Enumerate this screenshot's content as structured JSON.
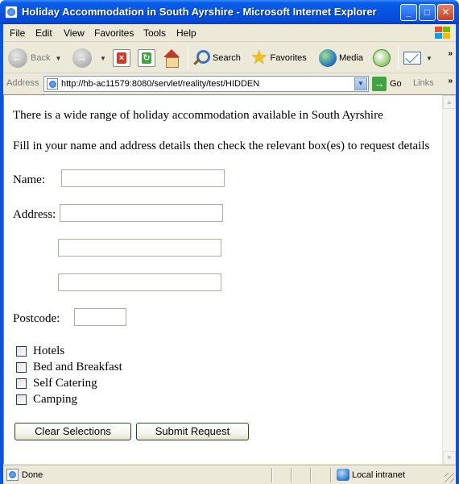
{
  "window": {
    "title": "Holiday Accommodation in South Ayrshire - Microsoft Internet Explorer",
    "min_glyph": "_",
    "max_glyph": "□",
    "close_glyph": "✕"
  },
  "menu": {
    "items": [
      {
        "label": "File"
      },
      {
        "label": "Edit"
      },
      {
        "label": "View"
      },
      {
        "label": "Favorites"
      },
      {
        "label": "Tools"
      },
      {
        "label": "Help"
      }
    ]
  },
  "toolbar": {
    "back_label": "Back",
    "search_label": "Search",
    "favorites_label": "Favorites",
    "media_label": "Media",
    "more_glyph": "»"
  },
  "address_bar": {
    "label": "Address",
    "url": "http://hb-ac11579:8080/servlet/reality/test/HIDDEN",
    "go_label": "Go",
    "links_label": "Links",
    "links_more": "»"
  },
  "page": {
    "intro": "There is a wide range of holiday accommodation available in South Ayrshire",
    "instructions": "Fill in your name and address details then check the relevant box(es) to request details",
    "form": {
      "name_label": "Name:",
      "address_label": "Address:",
      "postcode_label": "Postcode:",
      "name_value": "",
      "address_line1_value": "",
      "address_line2_value": "",
      "address_line3_value": "",
      "postcode_value": ""
    },
    "options": [
      {
        "label": "Hotels",
        "checked": false
      },
      {
        "label": "Bed and Breakfast",
        "checked": false
      },
      {
        "label": "Self Catering",
        "checked": false
      },
      {
        "label": "Camping",
        "checked": false
      }
    ],
    "clear_button": "Clear Selections",
    "submit_button": "Submit Request"
  },
  "status_bar": {
    "status": "Done",
    "zone": "Local intranet"
  }
}
